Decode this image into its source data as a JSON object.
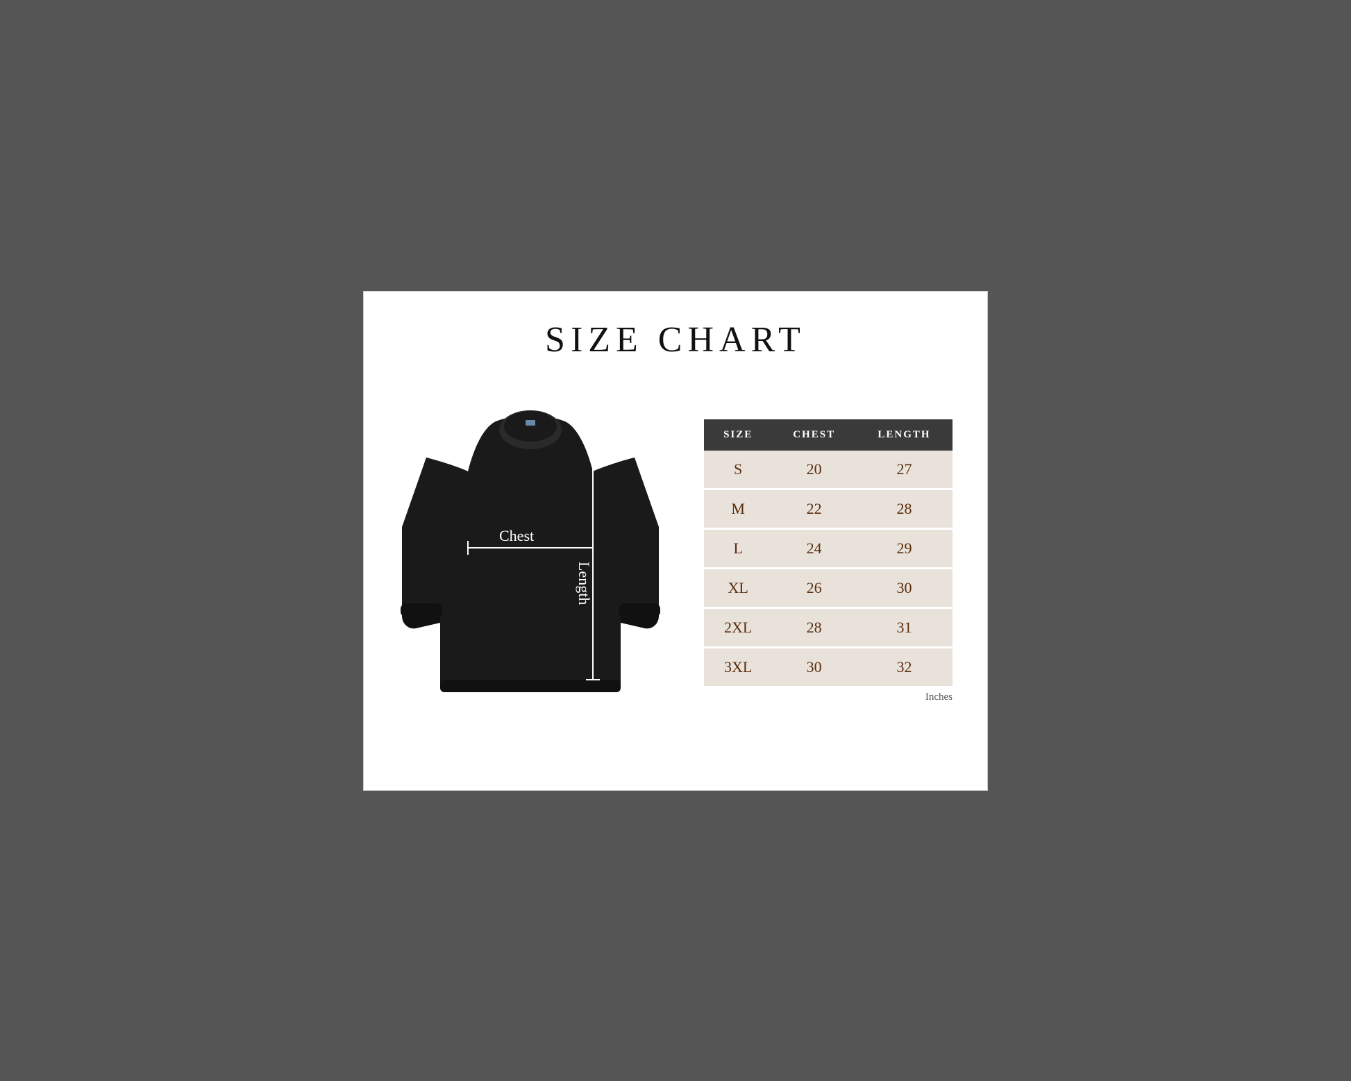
{
  "page": {
    "title": "SIZE CHART",
    "background": "#ffffff"
  },
  "table": {
    "headers": [
      "SIZE",
      "CHEST",
      "LENGTH"
    ],
    "rows": [
      {
        "size": "S",
        "chest": "20",
        "length": "27"
      },
      {
        "size": "M",
        "chest": "22",
        "length": "28"
      },
      {
        "size": "L",
        "chest": "24",
        "length": "29"
      },
      {
        "size": "XL",
        "chest": "26",
        "length": "30"
      },
      {
        "size": "2XL",
        "chest": "28",
        "length": "31"
      },
      {
        "size": "3XL",
        "chest": "30",
        "length": "32"
      }
    ],
    "unit": "Inches"
  },
  "diagram": {
    "chest_label": "Chest",
    "length_label": "Length"
  }
}
